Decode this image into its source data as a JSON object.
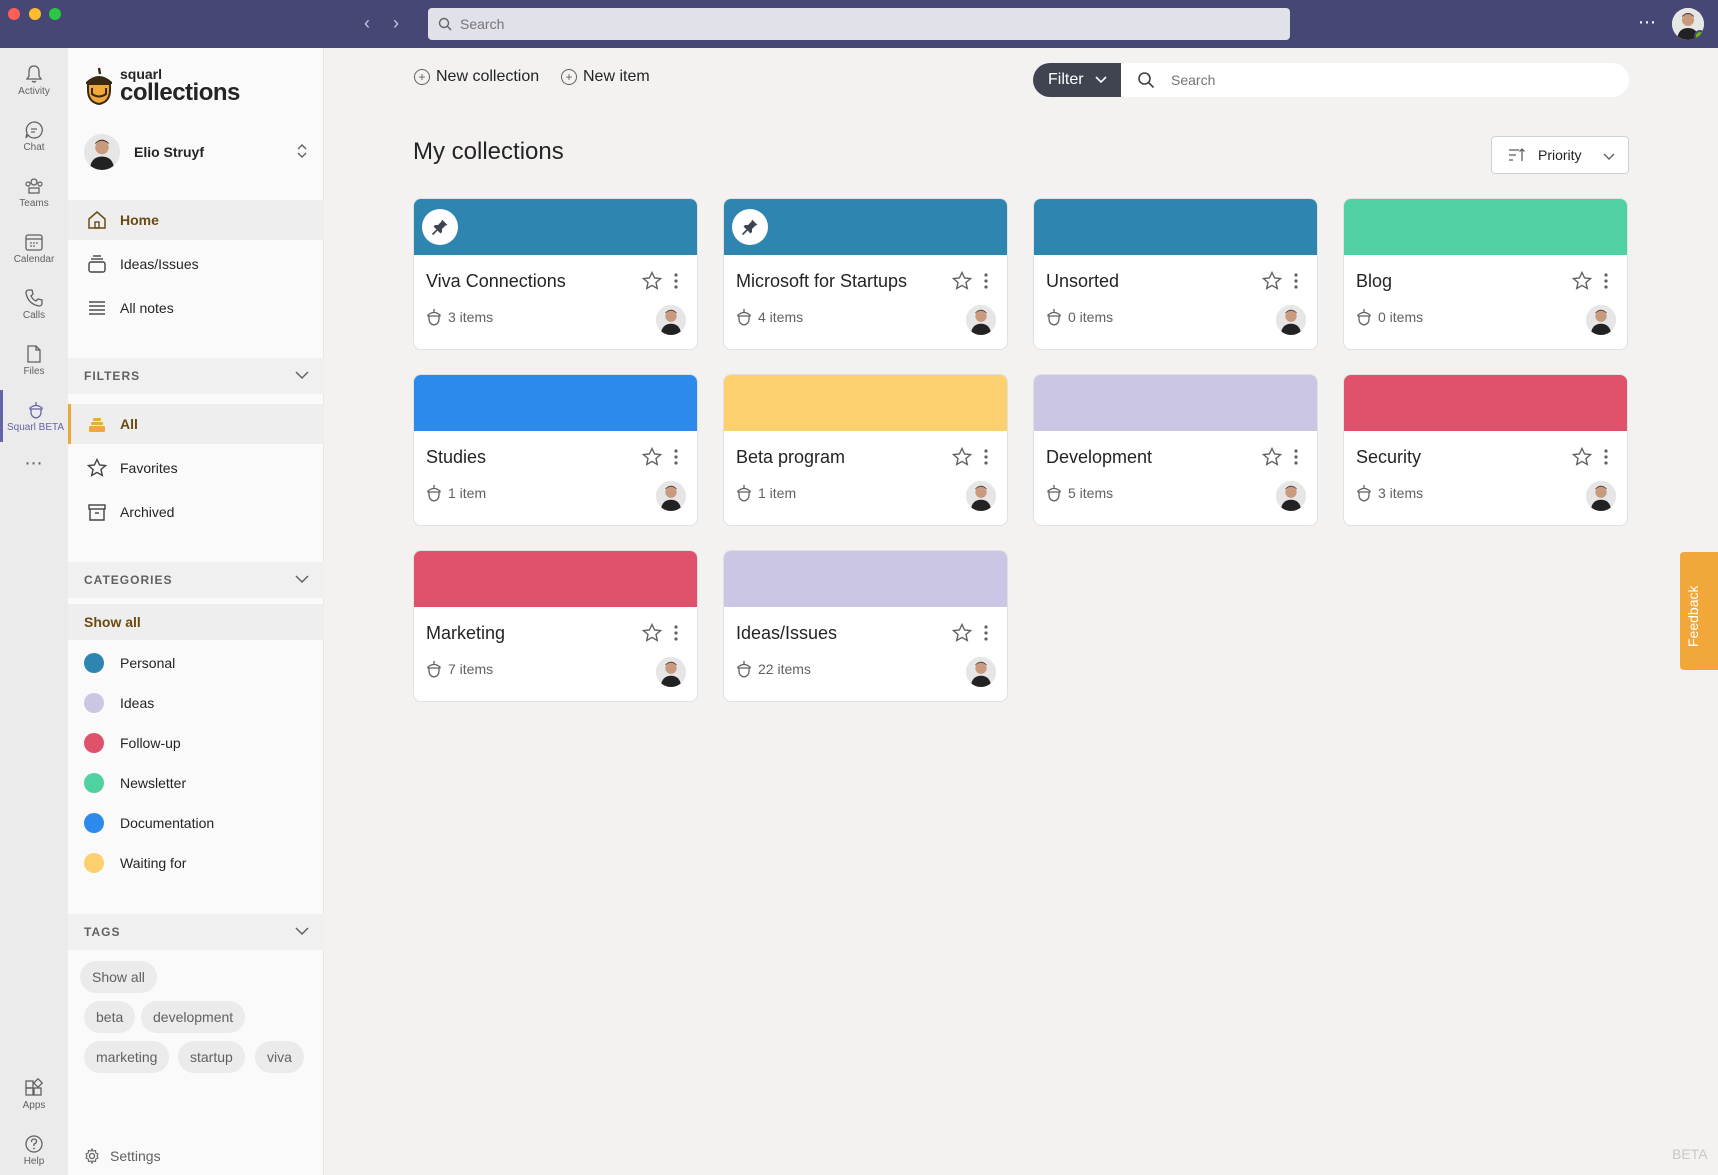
{
  "topbar": {
    "search_placeholder": "Search"
  },
  "rail": [
    {
      "label": "Activity",
      "icon": "bell-icon"
    },
    {
      "label": "Chat",
      "icon": "chat-icon"
    },
    {
      "label": "Teams",
      "icon": "teams-icon"
    },
    {
      "label": "Calendar",
      "icon": "calendar-icon"
    },
    {
      "label": "Calls",
      "icon": "phone-icon"
    },
    {
      "label": "Files",
      "icon": "file-icon"
    },
    {
      "label": "Squarl BETA",
      "icon": "acorn-icon"
    }
  ],
  "rail_bottom": [
    {
      "label": "Apps",
      "icon": "apps-icon"
    },
    {
      "label": "Help",
      "icon": "help-icon"
    }
  ],
  "sidebar": {
    "logo_small": "squarl",
    "logo_big": "collections",
    "user_name": "Elio Struyf",
    "nav": [
      {
        "label": "Home",
        "icon": "home-icon"
      },
      {
        "label": "Ideas/Issues",
        "icon": "stack-icon"
      },
      {
        "label": "All notes",
        "icon": "list-icon"
      }
    ],
    "filters_title": "FILTERS",
    "filters": [
      {
        "label": "All",
        "icon": "layers-icon"
      },
      {
        "label": "Favorites",
        "icon": "star-icon"
      },
      {
        "label": "Archived",
        "icon": "archive-icon"
      }
    ],
    "categories_title": "CATEGORIES",
    "categories_show_all": "Show all",
    "categories": [
      {
        "label": "Personal",
        "color": "#2e86b0"
      },
      {
        "label": "Ideas",
        "color": "#cbc6e3"
      },
      {
        "label": "Follow-up",
        "color": "#e0526c"
      },
      {
        "label": "Newsletter",
        "color": "#4fd1a2"
      },
      {
        "label": "Documentation",
        "color": "#2b8aec"
      },
      {
        "label": "Waiting for",
        "color": "#fcd06f"
      }
    ],
    "tags_title": "TAGS",
    "tags": [
      "Show all",
      "beta",
      "development",
      "marketing",
      "startup",
      "viva"
    ],
    "settings_label": "Settings"
  },
  "main": {
    "new_collection": "New collection",
    "new_item": "New item",
    "filter_label": "Filter",
    "search_placeholder": "Search",
    "title": "My collections",
    "sort_label": "Priority",
    "cards": [
      {
        "title": "Viva Connections",
        "count": "3 items",
        "color": "#2e86b0",
        "pinned": true
      },
      {
        "title": "Microsoft for Startups",
        "count": "4 items",
        "color": "#2e86b0",
        "pinned": true
      },
      {
        "title": "Unsorted",
        "count": "0 items",
        "color": "#2e86b0",
        "pinned": false
      },
      {
        "title": "Blog",
        "count": "0 items",
        "color": "#4fd1a2",
        "pinned": false
      },
      {
        "title": "Studies",
        "count": "1 item",
        "color": "#2b8aec",
        "pinned": false
      },
      {
        "title": "Beta program",
        "count": "1 item",
        "color": "#fcd06f",
        "pinned": false
      },
      {
        "title": "Development",
        "count": "5 items",
        "color": "#cbc6e3",
        "pinned": false
      },
      {
        "title": "Security",
        "count": "3 items",
        "color": "#e0526c",
        "pinned": false
      },
      {
        "title": "Marketing",
        "count": "7 items",
        "color": "#e0526c",
        "pinned": false
      },
      {
        "title": "Ideas/Issues",
        "count": "22 items",
        "color": "#cbc6e3",
        "pinned": false
      }
    ]
  },
  "feedback_label": "Feedback",
  "beta_label": "BETA"
}
